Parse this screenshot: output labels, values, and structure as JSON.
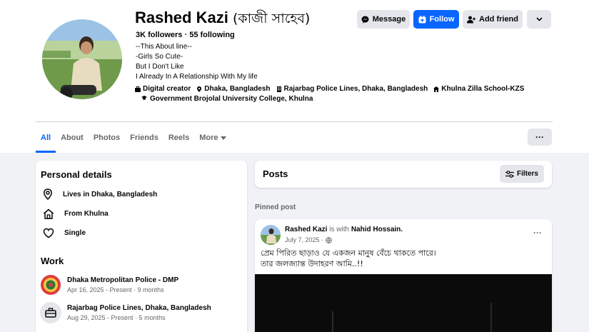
{
  "profile": {
    "name": "Rashed Kazi",
    "name_alt": "(কাজী সাহেব)",
    "followers": "3K followers",
    "following": "55 following",
    "bio_lines": [
      "--This About line--",
      "-Girls So Cute-",
      "But I Don't Like",
      "I Already In A Relationship With My life"
    ],
    "meta": {
      "category": "Digital creator",
      "location": "Dhaka, Bangladesh",
      "workplace": "Rajarbag Police Lines, Dhaka, Bangladesh",
      "school": "Khulna Zilla School-KZS",
      "college": "Government Brojolal University College, Khulna"
    }
  },
  "actions": {
    "message": "Message",
    "follow": "Follow",
    "add_friend": "Add friend"
  },
  "tabs": [
    {
      "label": "All"
    },
    {
      "label": "About"
    },
    {
      "label": "Photos"
    },
    {
      "label": "Friends"
    },
    {
      "label": "Reels"
    },
    {
      "label": "More"
    }
  ],
  "tabs_menu": "···",
  "personal_details": {
    "title": "Personal details",
    "items": [
      {
        "label": "Lives in Dhaka, Bangladesh",
        "icon": "location-pin-icon"
      },
      {
        "label": "From Khulna",
        "icon": "home-icon"
      },
      {
        "label": "Single",
        "icon": "heart-icon"
      }
    ]
  },
  "work": {
    "title": "Work",
    "items": [
      {
        "title": "Dhaka Metropolitan Police - DMP",
        "sub": "Apr 16, 2025 - Present · 9 months"
      },
      {
        "title": "Rajarbag Police Lines, Dhaka, Bangladesh",
        "sub": "Aug 29, 2025 - Present · 5 months"
      }
    ]
  },
  "posts": {
    "title": "Posts",
    "filters": "Filters",
    "pinned_label": "Pinned post"
  },
  "post": {
    "author": "Rashed Kazi",
    "with_text": "is with",
    "tagged": "Nahid Hossain.",
    "date": "July 7, 2025 ·",
    "menu": "···",
    "lines": [
      "প্রেম পিরিত ছাড়াও যে একজন মানুষ বেঁচে থাকতে পারে।",
      "তার জলজ্যান্ত উদাহরণ আমি..!!"
    ]
  },
  "colors": {
    "accent": "#0866ff",
    "button_gray": "#e4e6eb",
    "page_bg": "#f0f2f5",
    "text_secondary": "#65676b"
  }
}
